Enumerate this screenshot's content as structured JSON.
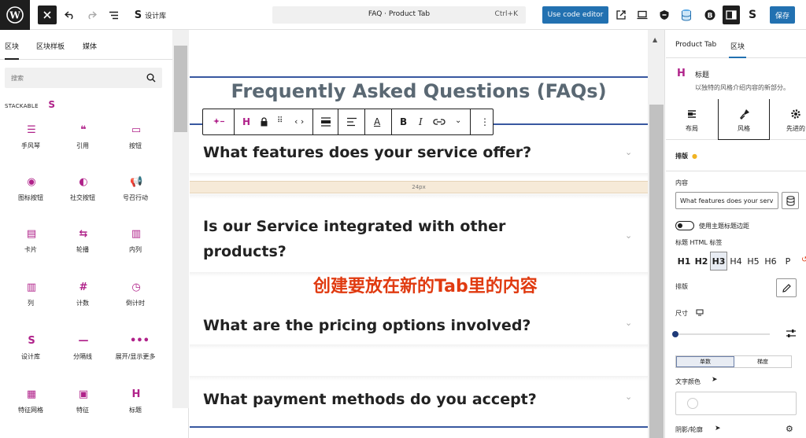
{
  "topbar": {
    "site_logo": "W",
    "designlib_label": "设计库",
    "doc_title": "FAQ · Product Tab",
    "shortcut": "Ctrl+K",
    "code_editor_label": "Use code editor",
    "save_label": "保存"
  },
  "left_panel": {
    "tabs": [
      "区块",
      "区块样板",
      "媒体"
    ],
    "search_placeholder": "搜索",
    "section_label": "STACKABLE",
    "blocks": [
      {
        "label": "手风琴",
        "icon": "accordion-icon"
      },
      {
        "label": "引用",
        "icon": "quote-icon"
      },
      {
        "label": "按钮",
        "icon": "button-icon"
      },
      {
        "label": "图标按钮",
        "icon": "icon-button-icon"
      },
      {
        "label": "社交按钮",
        "icon": "social-buttons-icon"
      },
      {
        "label": "号召行动",
        "icon": "call-to-action-icon"
      },
      {
        "label": "卡片",
        "icon": "card-icon"
      },
      {
        "label": "轮播",
        "icon": "carousel-icon"
      },
      {
        "label": "内列",
        "icon": "column-icon"
      },
      {
        "label": "列",
        "icon": "columns-icon"
      },
      {
        "label": "计数",
        "icon": "count-up-icon"
      },
      {
        "label": "倒计时",
        "icon": "countdown-icon"
      },
      {
        "label": "设计库",
        "icon": "design-library-icon"
      },
      {
        "label": "分隔线",
        "icon": "divider-icon"
      },
      {
        "label": "展开/显示更多",
        "icon": "expand-icon"
      },
      {
        "label": "特征网格",
        "icon": "feature-grid-icon"
      },
      {
        "label": "特征",
        "icon": "feature-icon"
      },
      {
        "label": "标题",
        "icon": "heading-icon"
      }
    ]
  },
  "canvas": {
    "faq_title": "Frequently Asked Questions (FAQs)",
    "spacer_label": "24px",
    "questions": [
      "What features does your service offer?",
      "Is our Service integrated with other products?",
      "What are the pricing options involved?",
      "What payment methods do you accept?"
    ],
    "annotation": "创建要放在新的Tab里的内容"
  },
  "right_panel": {
    "tabs": [
      "Product Tab",
      "区块"
    ],
    "block_icon": "H",
    "block_name": "标题",
    "block_desc": "以独特的风格介绍内容的新部分。",
    "style_tabs": [
      "布局",
      "风格",
      "先进的"
    ],
    "typography_label": "排版",
    "content_label": "内容",
    "content_value": "What features does your serv",
    "theme_margin_label": "使用主题标题边距",
    "html_tag_label": "标题 HTML 标签",
    "html_tags": [
      "H1",
      "H2",
      "H3",
      "H4",
      "H5",
      "H6",
      "P"
    ],
    "selected_tag": "H3",
    "typography_row_label": "排版",
    "size_label": "尺寸",
    "color_type_options": [
      "单数",
      "梯度"
    ],
    "text_color_label": "文字颜色",
    "shadow_label": "阴影/轮廓"
  },
  "colors": {
    "accent": "#2271b1",
    "stackable": "#b0228a",
    "annotation": "#e03a10"
  }
}
